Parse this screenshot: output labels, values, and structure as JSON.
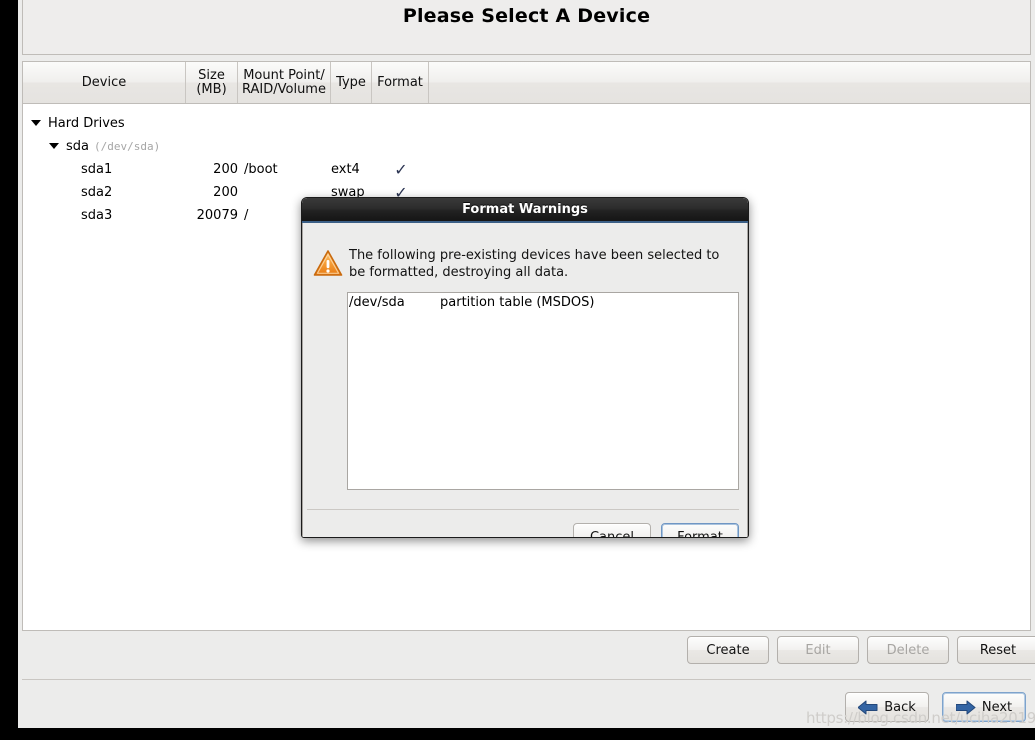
{
  "window": {
    "title": "Please Select A Device"
  },
  "table": {
    "columns": [
      {
        "label": "Device",
        "name": "device"
      },
      {
        "label_line1": "Size",
        "label_line2": "(MB)",
        "name": "size"
      },
      {
        "label_line1": "Mount Point/",
        "label_line2": "RAID/Volume",
        "name": "mount"
      },
      {
        "label": "Type",
        "name": "type"
      },
      {
        "label": "Format",
        "name": "format"
      }
    ],
    "rows": [
      {
        "device": "Hard Drives",
        "path": "",
        "size": "",
        "mount": "",
        "type": "",
        "format": "",
        "kind": "group",
        "expanded": true
      },
      {
        "device": "sda",
        "path": "(/dev/sda)",
        "size": "",
        "mount": "",
        "type": "",
        "format": "",
        "kind": "drive",
        "expanded": true
      },
      {
        "device": "sda1",
        "path": "",
        "size": "200",
        "mount": "/boot",
        "type": "ext4",
        "format": "✓",
        "kind": "partition"
      },
      {
        "device": "sda2",
        "path": "",
        "size": "200",
        "mount": "",
        "type": "swap",
        "format": "✓",
        "kind": "partition"
      },
      {
        "device": "sda3",
        "path": "",
        "size": "20079",
        "mount": "/",
        "type": "",
        "format": "",
        "kind": "partition"
      }
    ]
  },
  "toolbar": {
    "create_label": "Create",
    "edit_label": "Edit",
    "delete_label": "Delete",
    "reset_label": "Reset"
  },
  "nav": {
    "back_label": "Back",
    "next_label": "Next"
  },
  "watermark": {
    "text": "https://blog.csdn.net/uciha2019"
  },
  "dialog": {
    "title": "Format Warnings",
    "message": "The following pre-existing devices have been selected to be formatted, destroying all data.",
    "list": [
      {
        "device": "/dev/sda",
        "description": "partition table (MSDOS)"
      }
    ],
    "cancel_label": "Cancel",
    "format_label": "Format"
  },
  "colors": {
    "accent_blue": "#3b5f86",
    "warning_orange": "#f08b24",
    "check_navy": "#2b3452",
    "panel_bg": "#ececeb"
  }
}
